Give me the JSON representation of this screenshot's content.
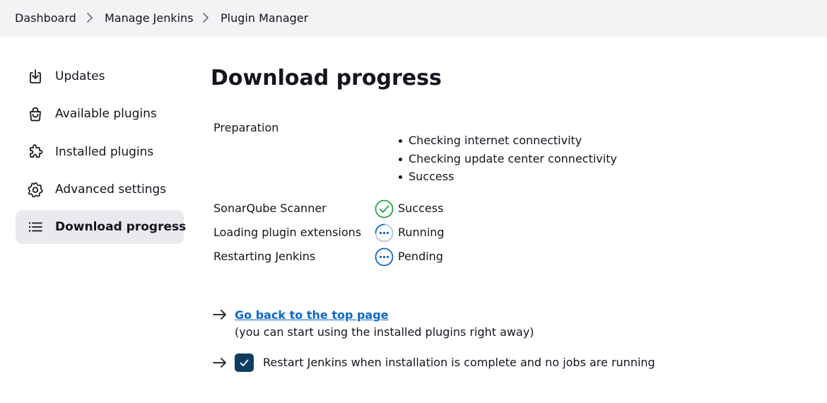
{
  "breadcrumb": [
    "Dashboard",
    "Manage Jenkins",
    "Plugin Manager"
  ],
  "sidebar": {
    "items": [
      {
        "label": "Updates",
        "icon": "download-icon",
        "active": false
      },
      {
        "label": "Available plugins",
        "icon": "shopping-bag-icon",
        "active": false
      },
      {
        "label": "Installed plugins",
        "icon": "puzzle-piece-icon",
        "active": false
      },
      {
        "label": "Advanced settings",
        "icon": "gear-icon",
        "active": false
      },
      {
        "label": "Download progress",
        "icon": "list-icon",
        "active": true
      }
    ]
  },
  "main": {
    "title": "Download progress",
    "preparation": {
      "label": "Preparation",
      "steps": [
        "Checking internet connectivity",
        "Checking update center connectivity",
        "Success"
      ]
    },
    "jobs": [
      {
        "name": "SonarQube Scanner",
        "status": "Success",
        "icon": "check-circle-icon"
      },
      {
        "name": "Loading plugin extensions",
        "status": "Running",
        "icon": "running-dots-icon"
      },
      {
        "name": "Restarting Jenkins",
        "status": "Pending",
        "icon": "pending-dots-icon"
      }
    ],
    "back_link": "Go back to the top page",
    "back_note": "(you can start using the installed plugins right away)",
    "restart_label": "Restart Jenkins when installation is complete and no jobs are running",
    "restart_checked": true
  },
  "colors": {
    "breadcrumb_bg": "#f3f3f6",
    "active_bg": "#e9e9ee",
    "link": "#0b67c7",
    "success": "#1ea446",
    "pending": "#0b67c7",
    "checkbox": "#0d3d63"
  }
}
